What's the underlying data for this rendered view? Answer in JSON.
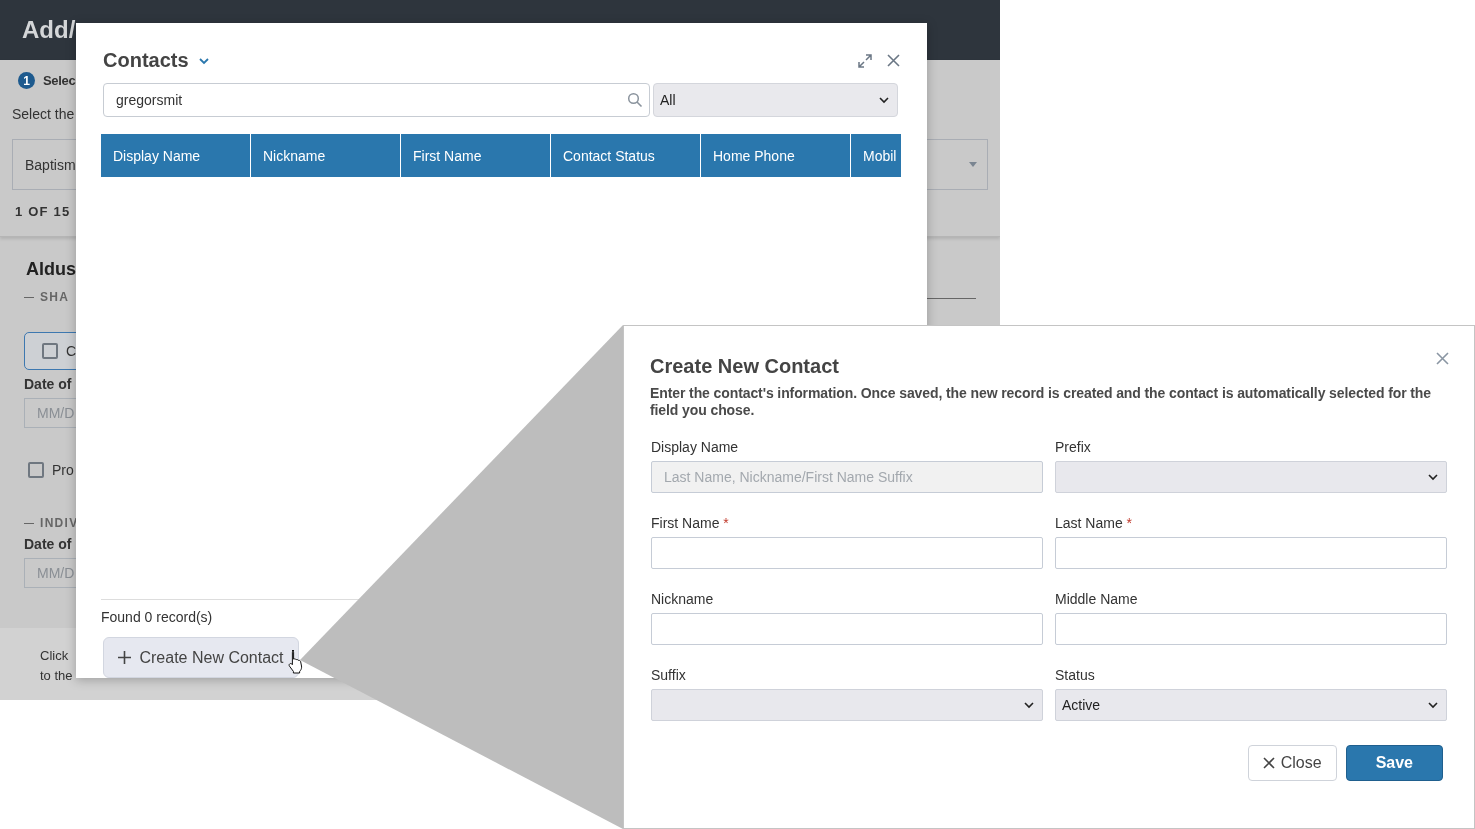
{
  "background_page": {
    "title": "Add/",
    "step": {
      "number": "1",
      "label": "Selec"
    },
    "instruction": "Select the",
    "dropdown": {
      "value": "Baptism"
    },
    "counter": "1 OF 15",
    "person_name": "Aldus",
    "sections": [
      {
        "kind": "heading",
        "label": "SHA"
      },
      {
        "kind": "option_box",
        "label": "C",
        "checked": false
      },
      {
        "kind": "date",
        "label": "Date of",
        "placeholder": "MM/D"
      },
      {
        "kind": "checkbox",
        "label": "Pro",
        "checked": false
      },
      {
        "kind": "heading",
        "label": "INDIV"
      },
      {
        "kind": "date",
        "label": "Date of",
        "placeholder": "MM/D"
      }
    ],
    "footer_lines": [
      "Click",
      "to the"
    ]
  },
  "contacts_dialog": {
    "title": "Contacts",
    "search": {
      "value": "gregorsmit"
    },
    "filter": {
      "value": "All"
    },
    "table": {
      "columns": [
        "Display Name",
        "Nickname",
        "First Name",
        "Contact Status",
        "Home Phone",
        "Mobil"
      ]
    },
    "found_text": "Found 0 record(s)",
    "create_button": "Create New Contact"
  },
  "create_contact_dialog": {
    "title": "Create New Contact",
    "required_mark": "*",
    "description": "Enter the contact's information. Once saved, the new record is created and the contact is automatically selected for the field you chose.",
    "fields": [
      {
        "kind": "text",
        "label": "Display Name",
        "required": false,
        "disabled": true,
        "placeholder": "Last Name, Nickname/First Name Suffix"
      },
      {
        "kind": "select",
        "label": "Prefix",
        "required": false,
        "disabled": false
      },
      {
        "kind": "text",
        "label": "First Name",
        "required": true,
        "disabled": false
      },
      {
        "kind": "text",
        "label": "Last Name",
        "required": true,
        "disabled": false
      },
      {
        "kind": "text",
        "label": "Nickname",
        "required": false,
        "disabled": false
      },
      {
        "kind": "text",
        "label": "Middle Name",
        "required": false,
        "disabled": false
      },
      {
        "kind": "select",
        "label": "Suffix",
        "required": false,
        "disabled": false
      },
      {
        "kind": "select",
        "label": "Status",
        "required": false,
        "disabled": false,
        "value": "Active"
      }
    ],
    "buttons": [
      {
        "kind": "secondary",
        "label": "Close"
      },
      {
        "kind": "primary",
        "label": "Save"
      }
    ]
  }
}
